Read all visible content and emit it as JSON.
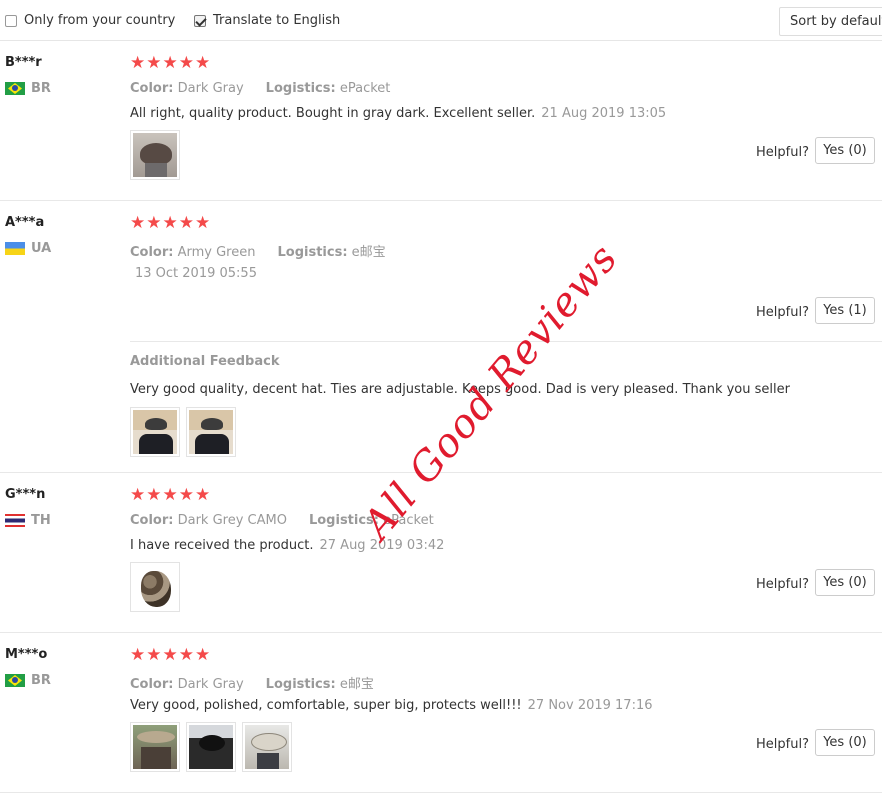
{
  "filters": {
    "only_country_label": "Only from your country",
    "only_country_checked": false,
    "translate_label": "Translate to English",
    "translate_checked": true,
    "sort_label": "Sort by default"
  },
  "labels": {
    "color": "Color:",
    "logistics": "Logistics:",
    "helpful": "Helpful?",
    "additional_feedback": "Additional Feedback"
  },
  "reviews": [
    {
      "user": "B***r",
      "country": "BR",
      "stars": "★★★★★",
      "color": "Dark Gray",
      "logistics": "ePacket",
      "text": "All right, quality product. Bought in gray dark. Excellent seller.",
      "date": "21 Aug 2019 13:05",
      "yes": "Yes (0)"
    },
    {
      "user": "A***a",
      "country": "UA",
      "stars": "★★★★★",
      "color": "Army Green",
      "logistics": "e邮宝",
      "date": "13 Oct 2019 05:55",
      "yes": "Yes (1)",
      "additional_text": "Very good quality, decent hat. Ties are adjustable. Keeps good. Dad is very pleased. Thank you seller"
    },
    {
      "user": "G***n",
      "country": "TH",
      "stars": "★★★★★",
      "color": "Dark Grey CAMO",
      "logistics": "ePacket",
      "text": "I have received the product.",
      "date": "27 Aug 2019 03:42",
      "yes": "Yes (0)"
    },
    {
      "user": "M***o",
      "country": "BR",
      "stars": "★★★★★",
      "color": "Dark Gray",
      "logistics": "e邮宝",
      "text": "Very good, polished, comfortable, super big, protects well!!!",
      "date": "27 Nov 2019 17:16",
      "yes": "Yes (0)"
    }
  ],
  "watermark": "All Good Reviews",
  "colors": {
    "star": "#f44a4a",
    "watermark": "#e01b2e",
    "muted": "#999999"
  }
}
